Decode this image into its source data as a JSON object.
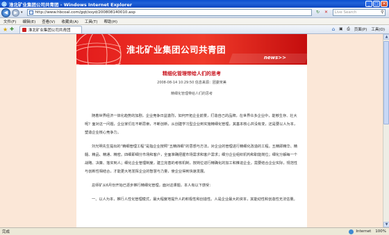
{
  "window": {
    "title": "淮北矿业集团公司共青团 - Windows Internet Explorer"
  },
  "address": {
    "url": "http://www.hbcoal.com/gqt/xsyd/200808140010.asp",
    "search_placeholder": "Live Search"
  },
  "menu": [
    "文件(F)",
    "编辑(E)",
    "查看(V)",
    "收藏夹(A)",
    "工具(T)",
    "帮助(H)"
  ],
  "tab": {
    "label": "淮北矿业集团公司共青团"
  },
  "toolbar": {
    "page": "页面(P)",
    "tools": "工具(O)"
  },
  "banner": {
    "site_name": "淮北矿业集团公司共青团",
    "news_label": "news>>"
  },
  "article": {
    "title": "精细化管理带给人们的思考",
    "meta": "2008-08-14  10:29:50    信息来源：团委宋美",
    "subtitle": "精细化管理带给人们的思考",
    "paragraphs": [
      "随着世界经济一体化趋势的加剧，企业竞争日益激烈，如何开拓企业前景，打造自己的品牌，在世界众多企业中，能够生存、壮大呢？面对这一问题，企业家们在不断思索，不断创新，从创建学习型企业到实施精细化管理，其基本核心并没有变，还是要以人为本，塑造企业核心竞争力。",
      "刘光明先生提出的“精细管理工程”是指企业按照“五精四细”的思想与方法，对企业的管理进行精细化改造的工程。五精即精华、精髓、精品、精通、精密。四细即细分市场和客户，全面准确把握市场需求和客户需求；细分企业组织机构和职能岗位；细化分解每一个战略、决策、落实到人；细化企业管理制度，建立完善的考核机制，按岗位进行精确化的加工和推进企业，需要结合企业实际，规范性与创新性相结合，才能更大地发挥企业的智慧与力量，使企业得到快速发展。",
      "总师矿从6月份开始已逐步推行精细化管理，面对这课题，本人有以下感受：",
      "一、以人为本，推行人性化管理模式，最大程度地提升人的积极性和创造性。人是企业最大的资本，其能动性和创造性无法估量。"
    ]
  },
  "status": {
    "left": "完成",
    "zone": "Internet",
    "zoom": "100%"
  }
}
